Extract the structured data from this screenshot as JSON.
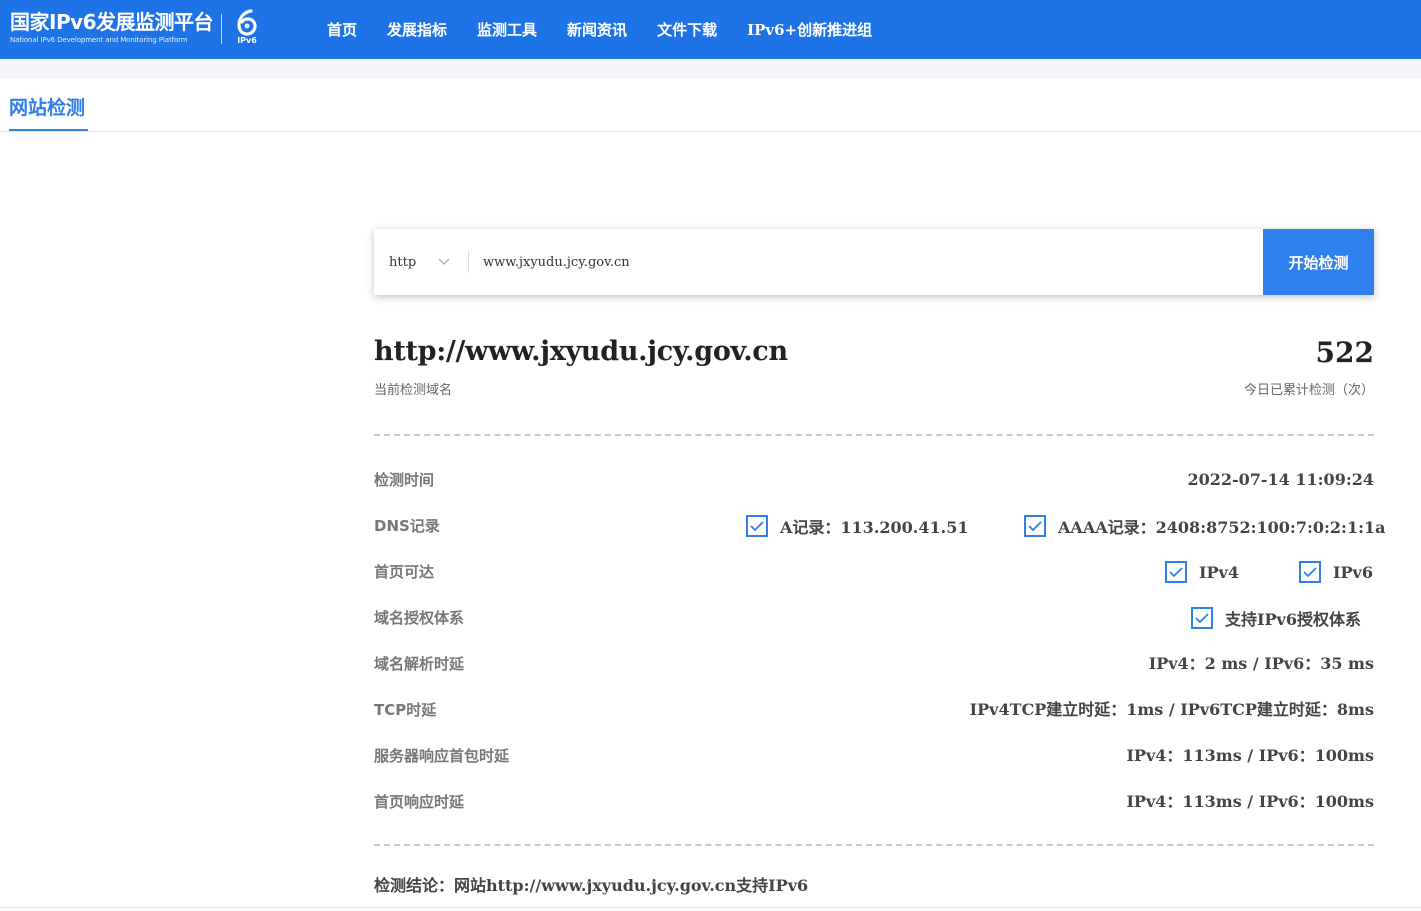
{
  "header": {
    "logo_title": "国家IPv6发展监测平台",
    "logo_subtitle": "National IPv6 Development and Monitoring Platform",
    "badge_text": "IPv6",
    "nav": [
      "首页",
      "发展指标",
      "监测工具",
      "新闻资讯",
      "文件下载",
      "IPv6+创新推进组"
    ],
    "color": "#1e74e6"
  },
  "tab": {
    "label": "网站检测",
    "accent": "#2f80ed"
  },
  "search": {
    "protocol": "http",
    "url_value": "www.jxyudu.jcy.gov.cn",
    "button_label": "开始检测"
  },
  "summary": {
    "domain": "http://www.jxyudu.jcy.gov.cn",
    "domain_caption": "当前检测域名",
    "count": "522",
    "count_caption": "今日已累计检测（次）"
  },
  "details": {
    "time": {
      "label": "检测时间",
      "value": "2022-07-14 11:09:24"
    },
    "dns": {
      "label": "DNS记录",
      "a_record": "A记录：113.200.41.51",
      "aaaa_record": "AAAA记录：2408:8752:100:7:0:2:1:1a"
    },
    "homepage": {
      "label": "首页可达",
      "ipv4": "IPv4",
      "ipv6": "IPv6"
    },
    "auth": {
      "label": "域名授权体系",
      "value": "支持IPv6授权体系"
    },
    "resolve": {
      "label": "域名解析时延",
      "value": "IPv4：2 ms / IPv6：35 ms"
    },
    "tcp": {
      "label": "TCP时延",
      "value": "IPv4TCP建立时延：1ms / IPv6TCP建立时延：8ms"
    },
    "first_packet": {
      "label": "服务器响应首包时延",
      "value": "IPv4：113ms / IPv6：100ms"
    },
    "page_response": {
      "label": "首页响应时延",
      "value": "IPv4：113ms / IPv6：100ms"
    }
  },
  "conclusion": "检测结论：网站http://www.jxyudu.jcy.gov.cn支持IPv6"
}
